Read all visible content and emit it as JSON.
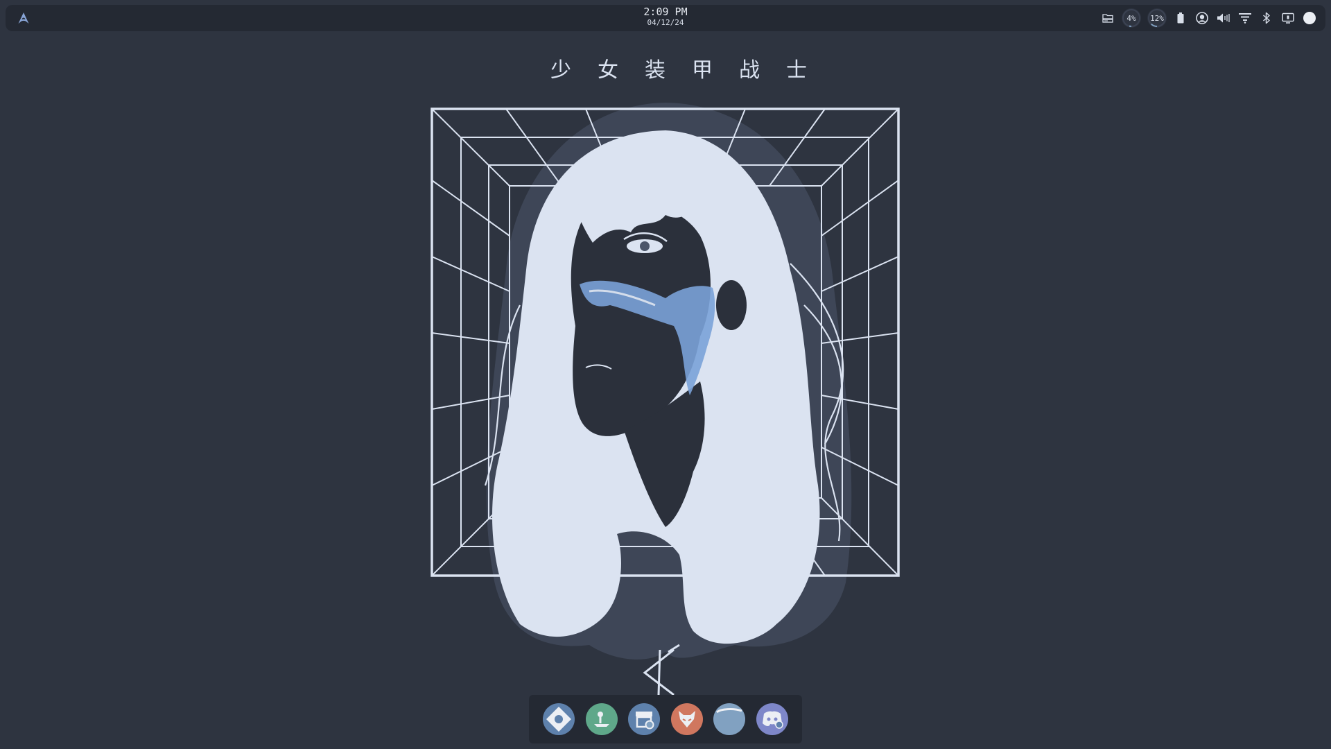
{
  "topbar": {
    "launcher_icon": "arch-linux-icon",
    "clock": {
      "time": "2:09 PM",
      "date": "04/12/24"
    },
    "tray": {
      "storage_icon": "folder-drive-icon",
      "cpu_percent": "4%",
      "cpu_fraction": 0.04,
      "ram_percent": "12%",
      "ram_fraction": 0.12,
      "battery_icon": "battery-icon",
      "account_icon": "user-account-icon",
      "volume_icon": "volume-icon",
      "wifi_icon": "wifi-icon",
      "bluetooth_icon": "bluetooth-icon",
      "display_icon": "screen-icon",
      "power_icon": "power-circle-icon"
    }
  },
  "wallpaper": {
    "title": "少女装甲战士",
    "colors": {
      "background": "#2e3440",
      "line": "#dbe3f1",
      "shadow": "#4c566a",
      "accent": "#7aa2d8"
    }
  },
  "dock": {
    "apps": [
      {
        "name": "settings",
        "icon": "settings-diamond-icon",
        "color": "#5e81ac"
      },
      {
        "name": "desktop-manager",
        "icon": "joystick-icon",
        "color": "#5fa88a"
      },
      {
        "name": "store",
        "icon": "store-icon",
        "color": "#5e81ac"
      },
      {
        "name": "firefox",
        "icon": "fox-icon",
        "color": "#d0775f"
      },
      {
        "name": "files",
        "icon": "folder-icon",
        "color": "#81a1c1"
      },
      {
        "name": "discord",
        "icon": "discord-icon",
        "color": "#7e87c9"
      }
    ]
  }
}
